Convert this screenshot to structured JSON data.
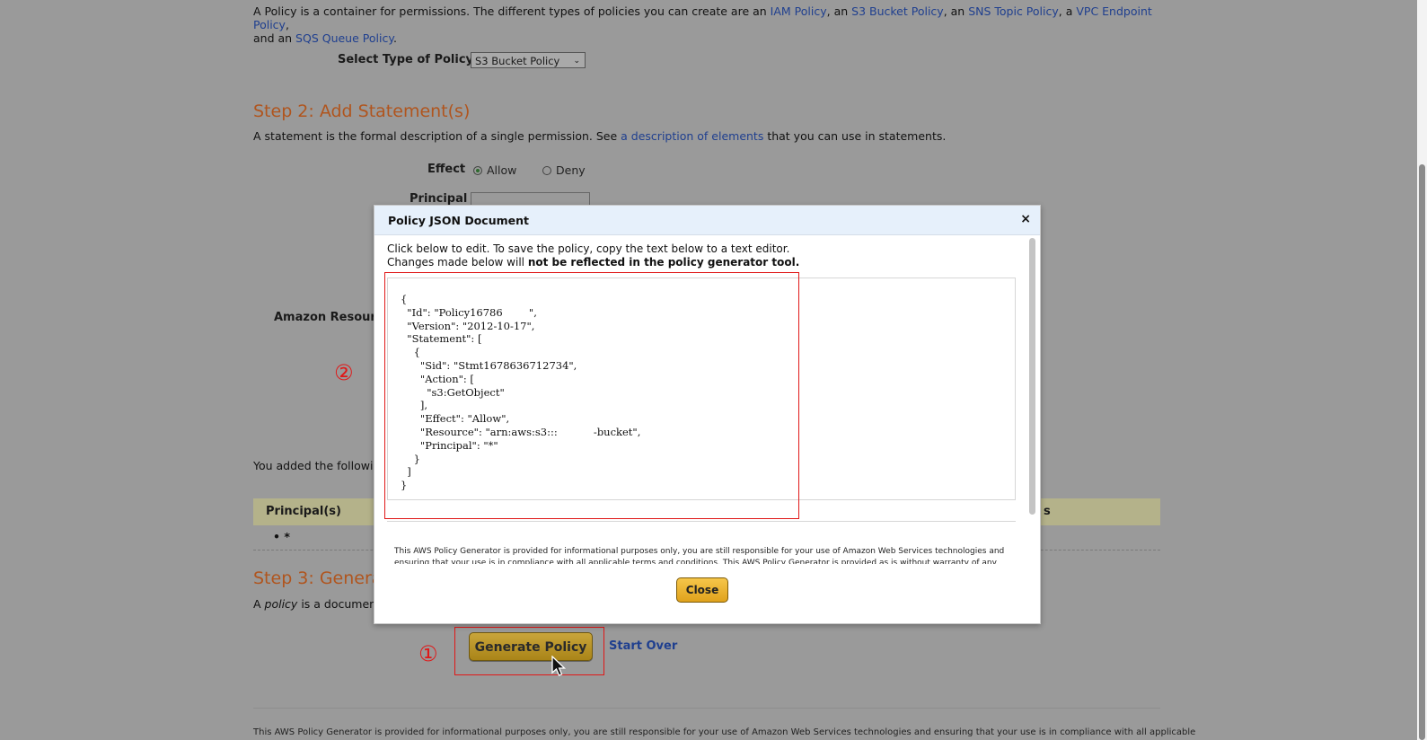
{
  "intro": {
    "text_before": "A Policy is a container for permissions. The different types of policies you can create are an ",
    "link_iam": "IAM Policy",
    "sep1": ", an ",
    "link_s3": "S3 Bucket Policy",
    "sep2": ", an ",
    "link_sns": "SNS Topic Policy",
    "sep3": ", a ",
    "link_vpc": "VPC Endpoint Policy",
    "sep4": ",",
    "line2_before": "and an ",
    "link_sqs": "SQS Queue Policy",
    "line2_after": "."
  },
  "policy_type": {
    "label": "Select Type of Policy",
    "selected": "S3 Bucket Policy"
  },
  "step2": {
    "title": "Step 2: Add Statement(s)",
    "desc_before": "A statement is the formal description of a single permission. See ",
    "desc_link": "a description of elements",
    "desc_after": " that you can use in statements.",
    "effect_label": "Effect",
    "effect_allow": "Allow",
    "effect_deny": "Deny",
    "principal_label": "Principal",
    "arn_label": "Amazon Resourc"
  },
  "added": {
    "text": "You added the followir",
    "col_principals": "Principal(s)",
    "col_right_tail": "s",
    "row_principal": "• *"
  },
  "step3": {
    "title": "Step 3: Genera",
    "desc_prefix": "A ",
    "desc_italic": "policy",
    "desc_rest": " is a documen"
  },
  "actions": {
    "generate": "Generate Policy",
    "start_over": "Start Over"
  },
  "annotations": {
    "one": "①",
    "two": "②"
  },
  "footer": "This AWS Policy Generator is provided for informational purposes only, you are still responsible for your use of Amazon Web Services technologies and ensuring that your use is in compliance with all applicable",
  "modal": {
    "title": "Policy JSON Document",
    "close_x": "×",
    "instr_line1": "Click below to edit. To save the policy, copy the text below to a text editor.",
    "instr_line2_before": "Changes made below will ",
    "instr_line2_bold": "not be reflected in the policy generator tool.",
    "json": "{\n  \"Id\": \"Policy16786        \",\n  \"Version\": \"2012-10-17\",\n  \"Statement\": [\n    {\n      \"Sid\": \"Stmt1678636712734\",\n      \"Action\": [\n        \"s3:GetObject\"\n      ],\n      \"Effect\": \"Allow\",\n      \"Resource\": \"arn:aws:s3:::           -bucket\",\n      \"Principal\": \"*\"\n    }\n  ]\n}",
    "disclaimer": "This AWS Policy Generator is provided for informational purposes only, you are still responsible for your use of Amazon Web Services technologies and ensuring that your use is in compliance with all applicable terms and conditions. This AWS Policy Generator is provided as is without warranty of any kind, whether",
    "close_button": "Close"
  }
}
